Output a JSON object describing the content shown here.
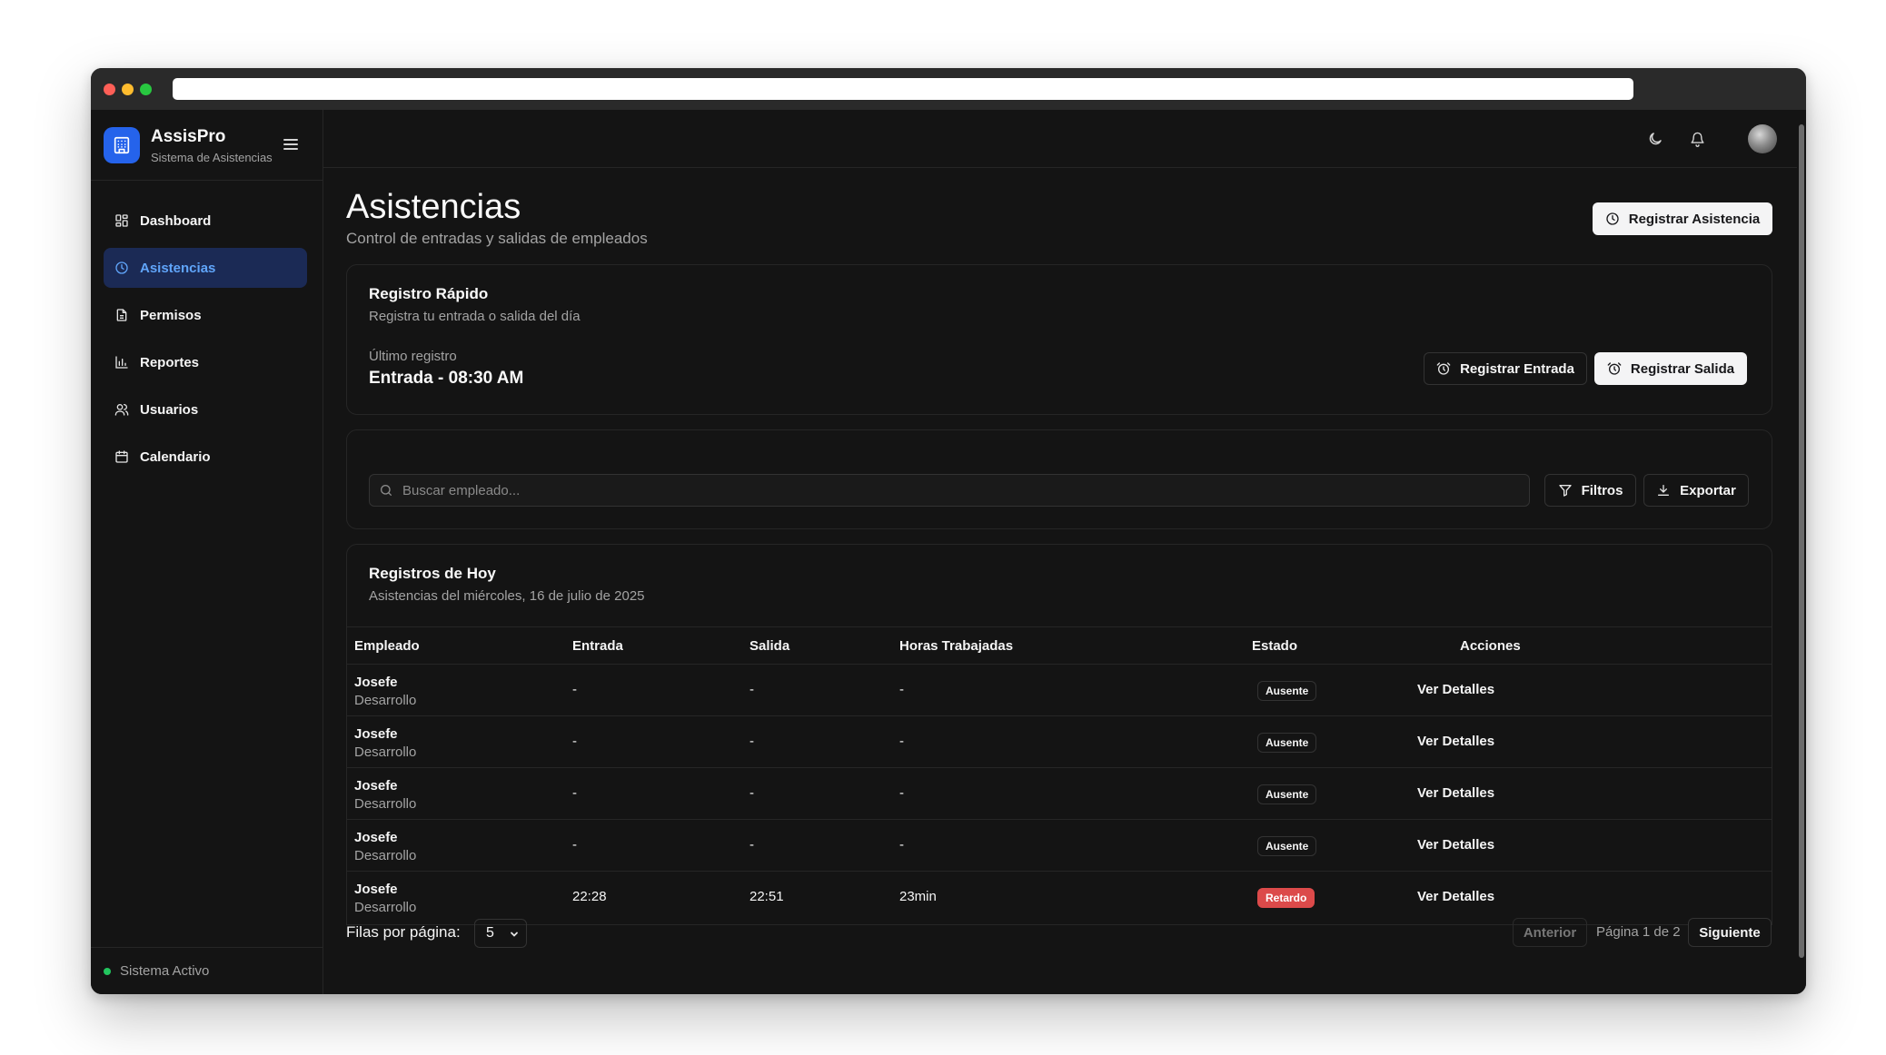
{
  "app": {
    "name": "AssisPro",
    "subtitle": "Sistema de Asistencias"
  },
  "sidebar": {
    "items": [
      {
        "label": "Dashboard",
        "icon": "dashboard-icon",
        "active": false
      },
      {
        "label": "Asistencias",
        "icon": "clock-icon",
        "active": true
      },
      {
        "label": "Permisos",
        "icon": "document-icon",
        "active": false
      },
      {
        "label": "Reportes",
        "icon": "bar-chart-icon",
        "active": false
      },
      {
        "label": "Usuarios",
        "icon": "users-icon",
        "active": false
      },
      {
        "label": "Calendario",
        "icon": "calendar-icon",
        "active": false
      }
    ],
    "footer_status": "Sistema Activo"
  },
  "header": {
    "title": "Asistencias",
    "subtitle": "Control de entradas y salidas de empleados",
    "register_button": "Registrar Asistencia"
  },
  "quick": {
    "title": "Registro Rápido",
    "subtitle": "Registra tu entrada o salida del día",
    "last_label": "Último registro",
    "last_value": "Entrada - 08:30 AM",
    "entrada_button": "Registrar Entrada",
    "salida_button": "Registrar Salida"
  },
  "search": {
    "placeholder": "Buscar empleado...",
    "filters_button": "Filtros",
    "export_button": "Exportar"
  },
  "records": {
    "title": "Registros de Hoy",
    "subtitle": "Asistencias del miércoles, 16 de julio de 2025",
    "columns": [
      "Empleado",
      "Entrada",
      "Salida",
      "Horas Trabajadas",
      "Estado",
      "Acciones"
    ],
    "rows": [
      {
        "name": "Josefe",
        "dept": "Desarrollo",
        "entrada": "-",
        "salida": "-",
        "horas": "-",
        "estado": "Ausente",
        "accion": "Ver Detalles"
      },
      {
        "name": "Josefe",
        "dept": "Desarrollo",
        "entrada": "-",
        "salida": "-",
        "horas": "-",
        "estado": "Ausente",
        "accion": "Ver Detalles"
      },
      {
        "name": "Josefe",
        "dept": "Desarrollo",
        "entrada": "-",
        "salida": "-",
        "horas": "-",
        "estado": "Ausente",
        "accion": "Ver Detalles"
      },
      {
        "name": "Josefe",
        "dept": "Desarrollo",
        "entrada": "-",
        "salida": "-",
        "horas": "-",
        "estado": "Ausente",
        "accion": "Ver Detalles"
      },
      {
        "name": "Josefe",
        "dept": "Desarrollo",
        "entrada": "22:28",
        "salida": "22:51",
        "horas": "23min",
        "estado": "Retardo",
        "accion": "Ver Detalles"
      }
    ]
  },
  "pagination": {
    "rows_label": "Filas por página:",
    "rows_value": "5",
    "prev": "Anterior",
    "info": "Página 1 de 2",
    "next": "Siguiente"
  },
  "colors": {
    "accent": "#2563eb",
    "active_bg": "#1b2a55",
    "active_text": "#60a5fa",
    "status_active": "#22c55e",
    "badge_retardo": "#dc4a4a"
  }
}
